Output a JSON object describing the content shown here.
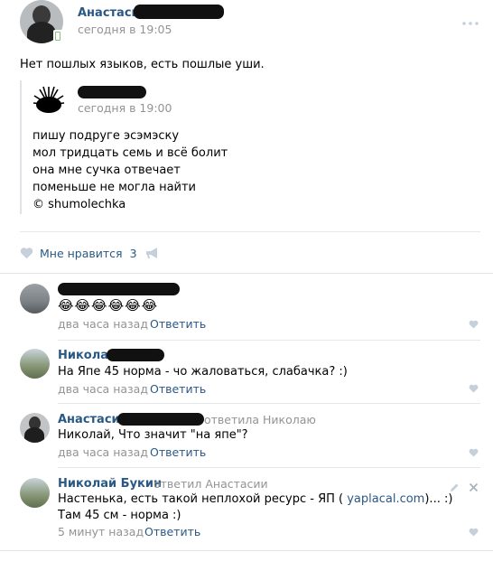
{
  "post": {
    "author": "Анастасия",
    "time": "сегодня в 19:05",
    "text": "Нет пошлых языков, есть пошлые уши.",
    "repost": {
      "time": "сегодня в 19:00",
      "lines": [
        "пишу подруге эсэмэску",
        "мол тридцать семь и всё болит",
        "она мне сучка отвечает",
        "поменьше не могла найти",
        "© shumolechka"
      ]
    },
    "like_label": "Мне нравится",
    "like_count": "3"
  },
  "comments": [
    {
      "author": "",
      "text": "😂😂😂😂😂😂",
      "time": "два часа назад",
      "reply": "Ответить"
    },
    {
      "author": "Николай",
      "text": "На Япе 45 норма - чо жаловаться, слабачка? :)",
      "time": "два часа назад",
      "reply": "Ответить"
    },
    {
      "author": "Анастасия",
      "reply_to": "ответила Николаю",
      "text": "Николай, Что значит \"на япе\"?",
      "time": "два часа назад",
      "reply": "Ответить"
    },
    {
      "author": "Николай Букин",
      "reply_to": "ответил Анастасии",
      "text_prefix": "Настенька, есть такой неплохой ресурс - ЯП ( ",
      "text_link": "yaplacal.com",
      "text_suffix": ")... :)",
      "text2": "Там 45 см - норма :)",
      "time": "5 минут назад",
      "reply": "Ответить"
    }
  ],
  "colors": {
    "link": "#2a5885",
    "meta": "#939393",
    "divider": "#e7e8ec",
    "icon": "#c5d0db"
  }
}
